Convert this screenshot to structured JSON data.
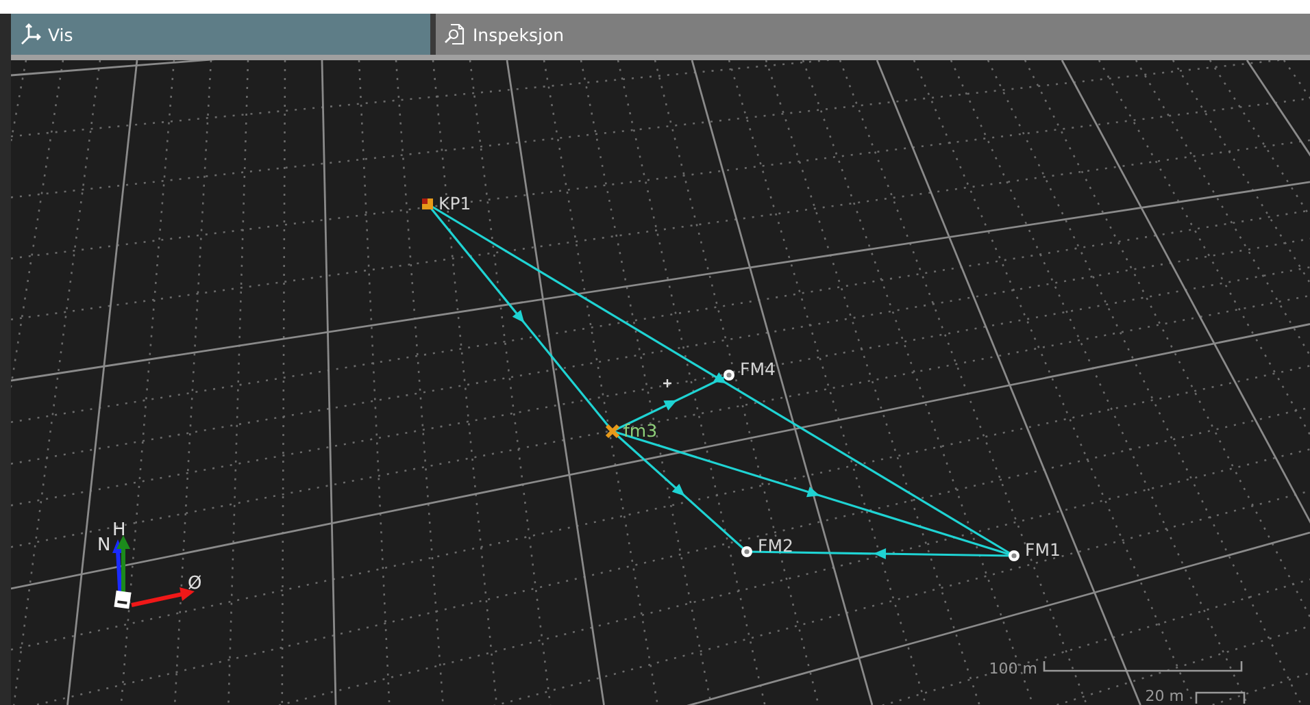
{
  "tabs": [
    {
      "label": "Vis",
      "kind": "view",
      "selected": true
    },
    {
      "label": "Inspeksjon",
      "kind": "inspection",
      "selected": false
    }
  ],
  "points": [
    {
      "label": "KP1",
      "kind": "control"
    },
    {
      "label": "FM4",
      "kind": "fixed"
    },
    {
      "label": "fm3",
      "kind": "new"
    },
    {
      "label": "FM2",
      "kind": "fixed"
    },
    {
      "label": "FM1",
      "kind": "fixed"
    }
  ],
  "axis_gizmo": {
    "up": "H",
    "north": "N",
    "east": "Ø"
  },
  "scale_bars": [
    {
      "label": "100 m"
    },
    {
      "label": "20 m"
    }
  ]
}
